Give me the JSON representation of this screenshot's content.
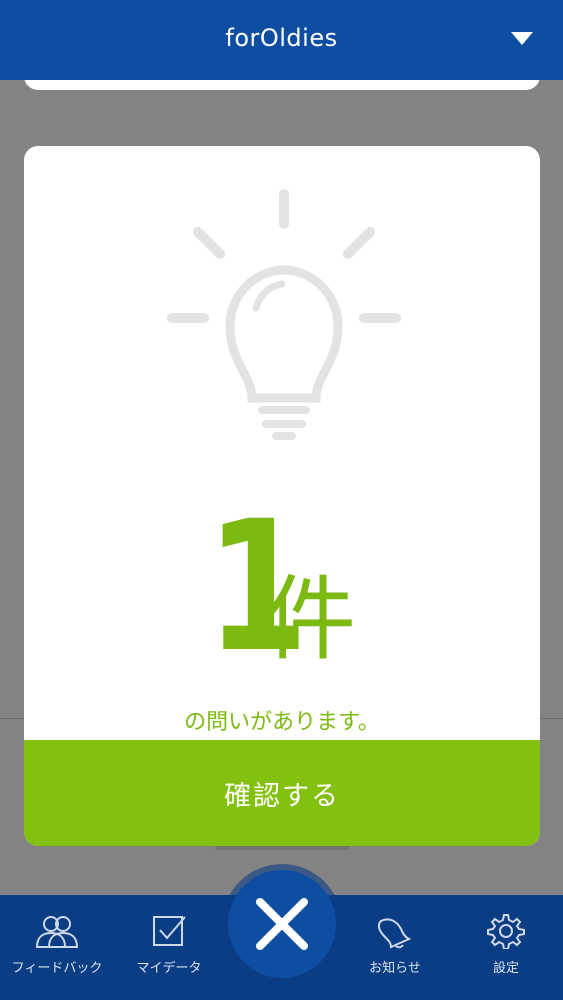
{
  "header": {
    "title": "forOldies",
    "menu_icon": "chevron-down-icon"
  },
  "modal": {
    "icon": "lightbulb-icon",
    "count": "1",
    "unit": "件",
    "caption": "の問いがあります。",
    "confirm_label": "確認する"
  },
  "tabbar": {
    "items": [
      {
        "label": "フィードバック",
        "icon": "people-icon"
      },
      {
        "label": "マイデータ",
        "icon": "checkbox-icon"
      },
      {
        "label": "お知らせ",
        "icon": "bell-icon"
      },
      {
        "label": "設定",
        "icon": "gear-icon"
      }
    ],
    "close_icon": "close-icon"
  },
  "colors": {
    "header": "#0d4ea3",
    "tabbar": "#0b3d85",
    "accent_green": "#84c00f",
    "icon_gray": "#e3e3e6"
  }
}
